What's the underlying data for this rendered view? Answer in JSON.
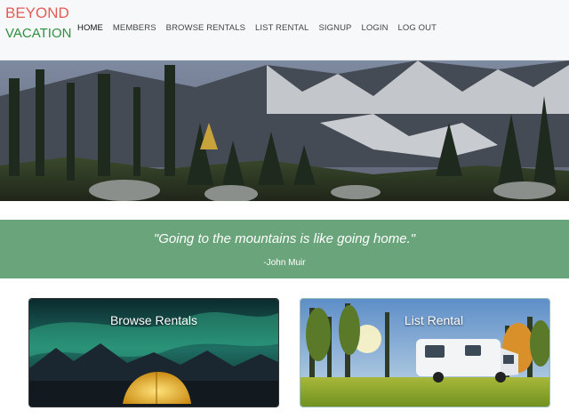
{
  "brand": {
    "line1": "BEYOND",
    "line2": "VACATION"
  },
  "nav": {
    "items": [
      {
        "label": "HOME",
        "active": true
      },
      {
        "label": "MEMBERS"
      },
      {
        "label": "BROWSE RENTALS"
      },
      {
        "label": "LIST RENTAL"
      },
      {
        "label": "SIGNUP"
      },
      {
        "label": "LOGIN"
      },
      {
        "label": "LOG OUT"
      }
    ]
  },
  "quote": {
    "text": "\"Going to the mountains is like going home.\"",
    "author": "-John Muir"
  },
  "cards": [
    {
      "label": "Browse Rentals"
    },
    {
      "label": "List Rental"
    }
  ],
  "colors": {
    "brand_red": "#e35b55",
    "brand_green": "#2f8f3e",
    "quote_band": "#6aa47a"
  }
}
